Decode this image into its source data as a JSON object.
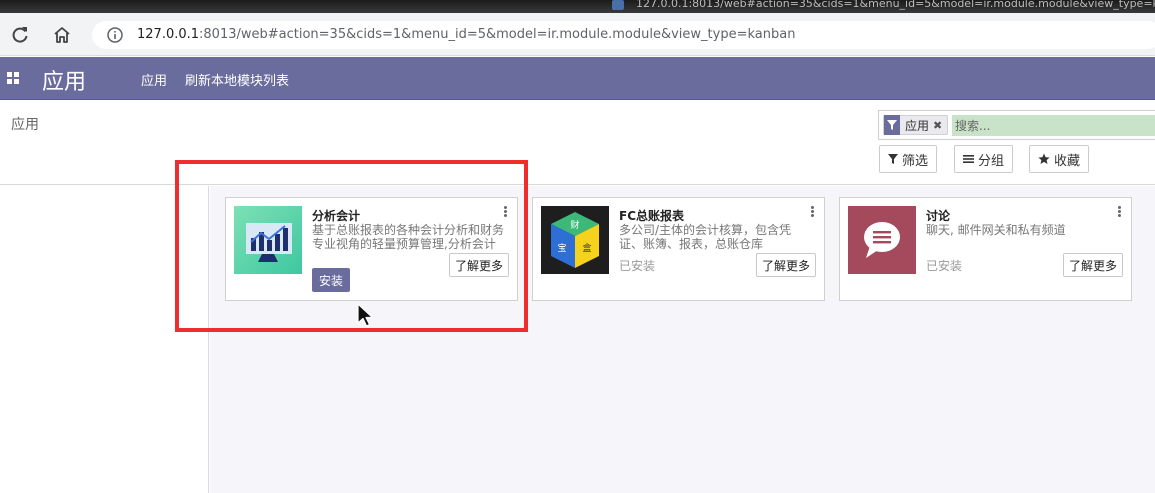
{
  "window": {
    "title": "127.0.0.1:8013/web#action=35&cids=1&menu_id=5&model=ir.module.module&view_type=kanban"
  },
  "browser": {
    "url_host": "127.0.0.1",
    "url_rest": ":8013/web#action=35&cids=1&menu_id=5&model=ir.module.module&view_type=kanban",
    "icons": {
      "reload": "reload-icon",
      "home": "home-icon",
      "info": "info-icon"
    }
  },
  "navbar": {
    "brand": "应用",
    "menu": [
      "应用",
      "刷新本地模块列表"
    ]
  },
  "control_panel": {
    "breadcrumb": "应用",
    "search": {
      "facet_label": "应用",
      "placeholder": "搜索..."
    },
    "buttons": {
      "filter": "筛选",
      "group": "分组",
      "favorites": "收藏"
    }
  },
  "cards": [
    {
      "title": "分析会计",
      "description": "基于总账报表的各种会计分析和财务专业视角的轻量预算管理,分析会计",
      "install_label": "安装",
      "learn_more": "了解更多",
      "installed": false
    },
    {
      "title": "FC总账报表",
      "description": "多公司/主体的会计核算，包含凭证、账簿、报表，总账仓库",
      "state": "已安装",
      "learn_more": "了解更多",
      "installed": true,
      "icon_glyphs": [
        "财",
        "宝",
        "盒"
      ]
    },
    {
      "title": "讨论",
      "description": "聊天, 邮件网关和私有频道",
      "state": "已安装",
      "learn_more": "了解更多",
      "installed": true
    }
  ],
  "colors": {
    "navbar": "#6b6c9e",
    "highlight": "#ee2d2d",
    "discuss_icon": "#a54a5d"
  }
}
